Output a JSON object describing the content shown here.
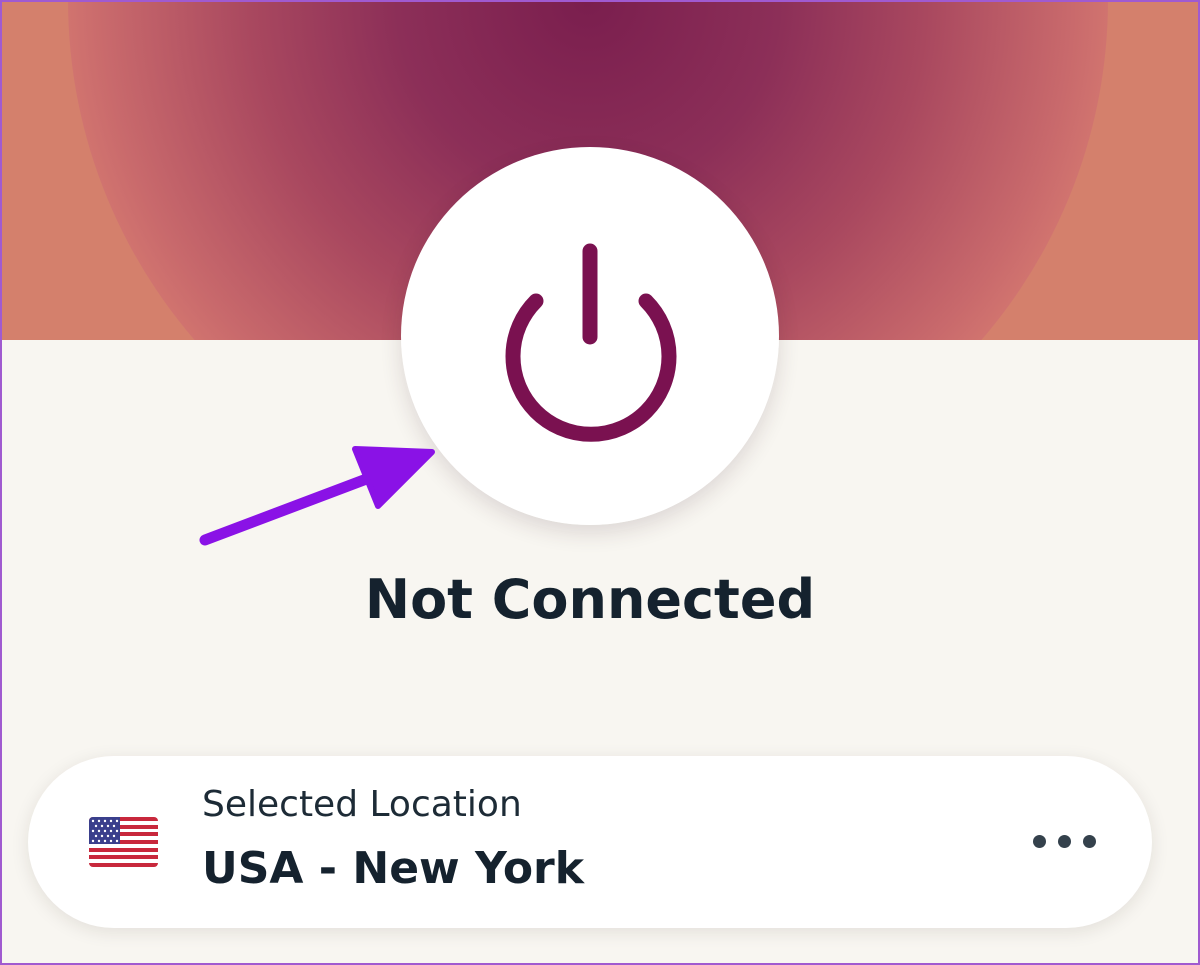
{
  "status": {
    "text": "Not Connected"
  },
  "location": {
    "label": "Selected Location",
    "value": "USA - New York",
    "flag_icon": "us-flag-icon"
  },
  "icons": {
    "power": "power-icon",
    "more": "more-options-icon",
    "annotation": "annotation-arrow-icon"
  },
  "colors": {
    "power_icon": "#7a1150",
    "annotation_arrow": "#8a12e6",
    "status_text": "#15222e",
    "background": "#f8f6f1",
    "header_outer": "#d4806c",
    "header_glow_center": "#7a1e4e"
  }
}
